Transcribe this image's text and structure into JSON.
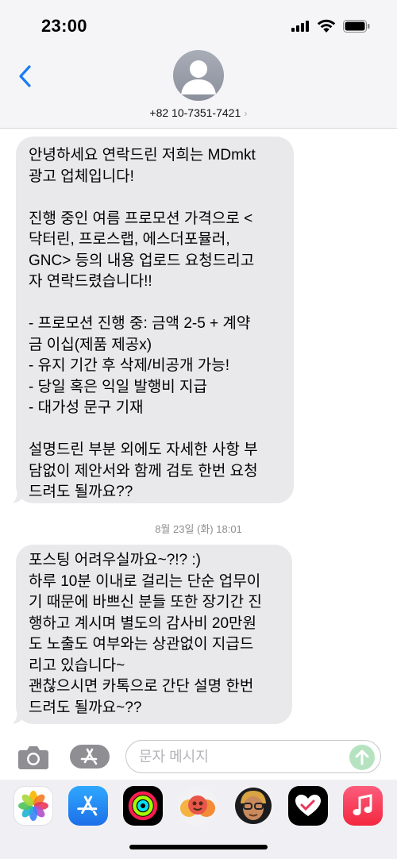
{
  "status_bar": {
    "time": "23:00"
  },
  "header": {
    "contact_number": "+82 10-7351-7421",
    "chevron": "›"
  },
  "messages": [
    {
      "sender": "incoming",
      "text": "안녕하세요 연락드린 저희는 MDmkt\n광고 업체입니다!\n\n진행 중인 여름 프로모션 가격으로 <\n닥터린, 프로스랩, 에스더포뮬러,\nGNC> 등의 내용 업로드 요청드리고\n자 연락드렸습니다!!\n\n- 프로모션 진행 중: 금액 2-5 + 계약\n금 이십(제품 제공x)\n- 유지 기간 후 삭제/비공개 가능!\n- 당일 혹은 익일 발행비 지급\n- 대가성 문구 기재\n\n설명드린 부분 외에도 자세한 사항 부\n담없이 제안서와 함께 검토 한번 요청\n드려도 될까요??"
    },
    {
      "sender": "incoming",
      "text": "포스팅 어려우실까요~?!? :)\n하루 10분 이내로 걸리는 단순 업무이\n기 때문에 바쁘신 분들 또한 장기간 진\n행하고 계시며 별도의 감사비 20만원\n도 노출도 여부와는 상관없이 지급드\n리고 있습니다~\n괜찮으시면 카톡으로 간단 설명 한번\n드려도 될까요~??"
    }
  ],
  "timestamp": "8월 23일 (화) 18:01",
  "input": {
    "placeholder": "문자 메시지"
  },
  "app_strip": {
    "apps": [
      "photos-app-icon",
      "app-store-icon",
      "activity-app-icon",
      "memoji-stickers-icon",
      "memoji-icon",
      "heart-digital-touch-icon",
      "music-app-icon"
    ]
  },
  "colors": {
    "accent_blue": "#1a7cf5",
    "bubble_gray": "#e9e9eb",
    "send_green": "#b5e3c0",
    "header_bg": "#f5f5f7"
  }
}
